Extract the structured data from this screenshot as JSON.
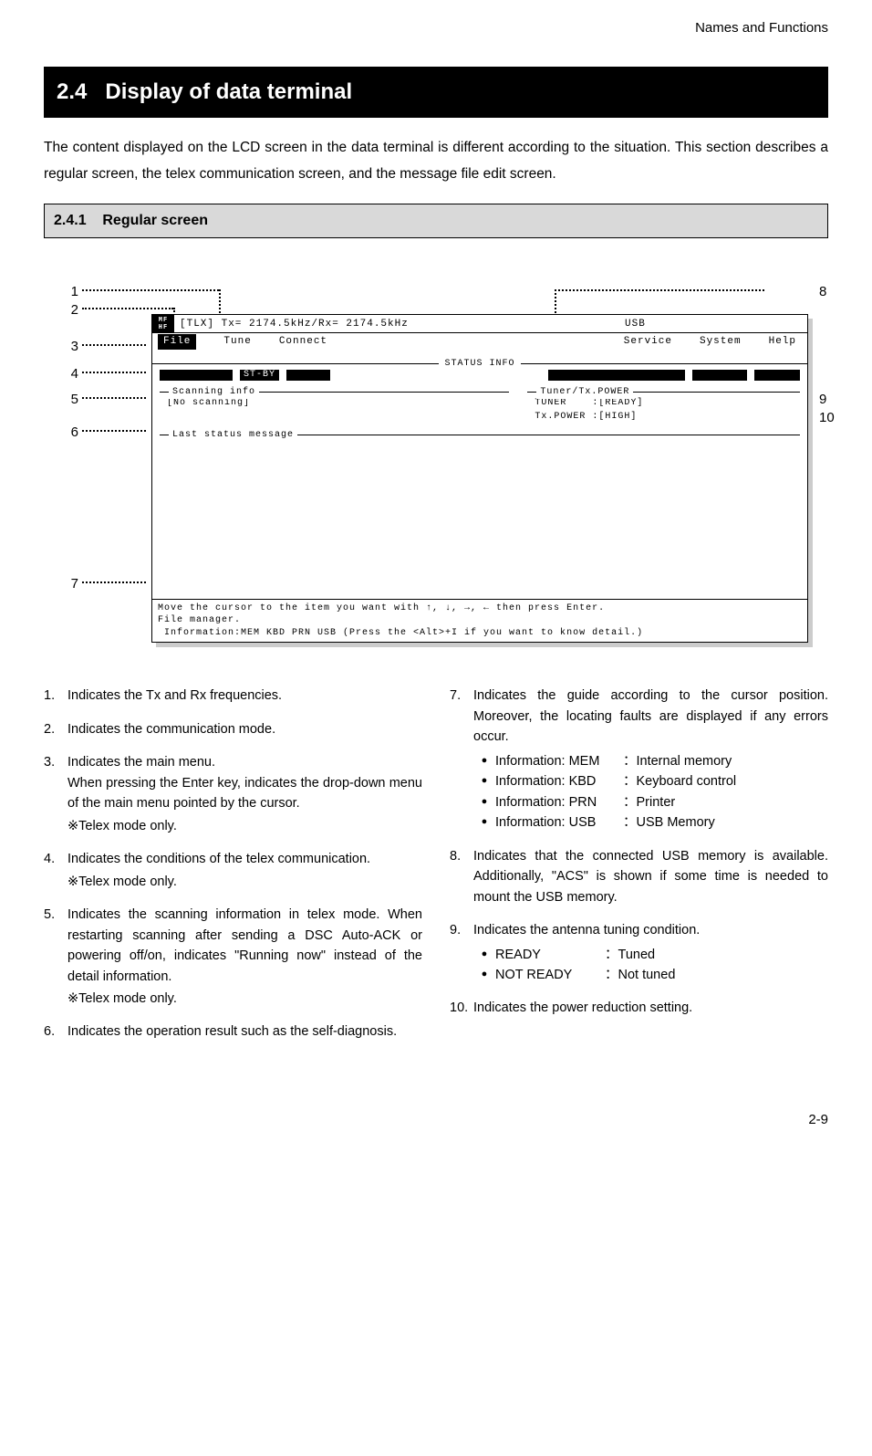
{
  "header": {
    "right": "Names and Functions"
  },
  "section": {
    "number": "2.4",
    "title": "Display of data terminal",
    "intro": "The content displayed on the LCD screen in the data terminal is different according to the situation. This section describes a regular screen, the telex communication screen, and the message file edit screen."
  },
  "subsection": {
    "number": "2.4.1",
    "title": "Regular screen"
  },
  "callouts": {
    "left": [
      "1",
      "2",
      "3",
      "4",
      "5",
      "6",
      "7"
    ],
    "right": [
      "8",
      "9",
      "10"
    ]
  },
  "terminal": {
    "badge_top": "MF",
    "badge_bottom": "HF",
    "freq": "[TLX] Tx= 2174.5kHz/Rx= 2174.5kHz",
    "usb": "USB",
    "menu": {
      "file": "File",
      "tune": "Tune",
      "connect": "Connect",
      "service": "Service",
      "system": "System",
      "help": "Help"
    },
    "status_info": "STATUS INFO",
    "stby": "ST-BY",
    "scanning_legend": "Scanning info",
    "scanning_value": "[No scanning]",
    "tuner_legend": "Tuner/Tx.POWER",
    "tuner_line1": "TUNER    :[READY]",
    "tuner_line2": "Tx.POWER :[HIGH]",
    "last_status_legend": "Last status message",
    "footer_line1": "Move the cursor to the item you want with ↑, ↓, →, ← then press Enter.",
    "footer_line2": "File manager.",
    "footer_line3": " Information:MEM KBD PRN USB (Press the <Alt>+I if you want to know detail.)"
  },
  "descriptions_left": [
    {
      "n": "1.",
      "text": "Indicates the Tx and Rx frequencies."
    },
    {
      "n": "2.",
      "text": "Indicates the communication mode."
    },
    {
      "n": "3.",
      "text": "Indicates the main menu.\nWhen pressing the Enter key, indicates the drop-down menu of the main menu pointed by the cursor.",
      "note": "※Telex mode only."
    },
    {
      "n": "4.",
      "text": "Indicates the conditions of the telex communication.",
      "note": "※Telex mode only."
    },
    {
      "n": "5.",
      "text": "Indicates the scanning information in telex mode. When restarting scanning after sending a DSC Auto-ACK or powering off/on, indicates \"Running now\" instead of the detail information.",
      "note": "※Telex mode only."
    },
    {
      "n": "6.",
      "text": "Indicates the operation result such as the self-diagnosis."
    }
  ],
  "descriptions_right": [
    {
      "n": "7.",
      "text": "Indicates the guide according to the cursor position. Moreover, the locating faults are displayed if any errors occur.",
      "bullets": [
        {
          "label": "Information: MEM",
          "val": "Internal memory"
        },
        {
          "label": "Information: KBD",
          "val": "Keyboard control"
        },
        {
          "label": "Information: PRN",
          "val": "Printer"
        },
        {
          "label": "Information: USB",
          "val": "USB Memory"
        }
      ]
    },
    {
      "n": "8.",
      "text": "Indicates that the connected USB memory is available. Additionally, \"ACS\" is shown if some time is needed to mount the USB memory."
    },
    {
      "n": "9.",
      "text": "Indicates the antenna tuning condition.",
      "bullets2": [
        {
          "label": "READY",
          "val": "Tuned"
        },
        {
          "label": "NOT READY",
          "val": "Not tuned"
        }
      ]
    },
    {
      "n": "10.",
      "text": "Indicates the power reduction setting."
    }
  ],
  "page_number": "2-9"
}
